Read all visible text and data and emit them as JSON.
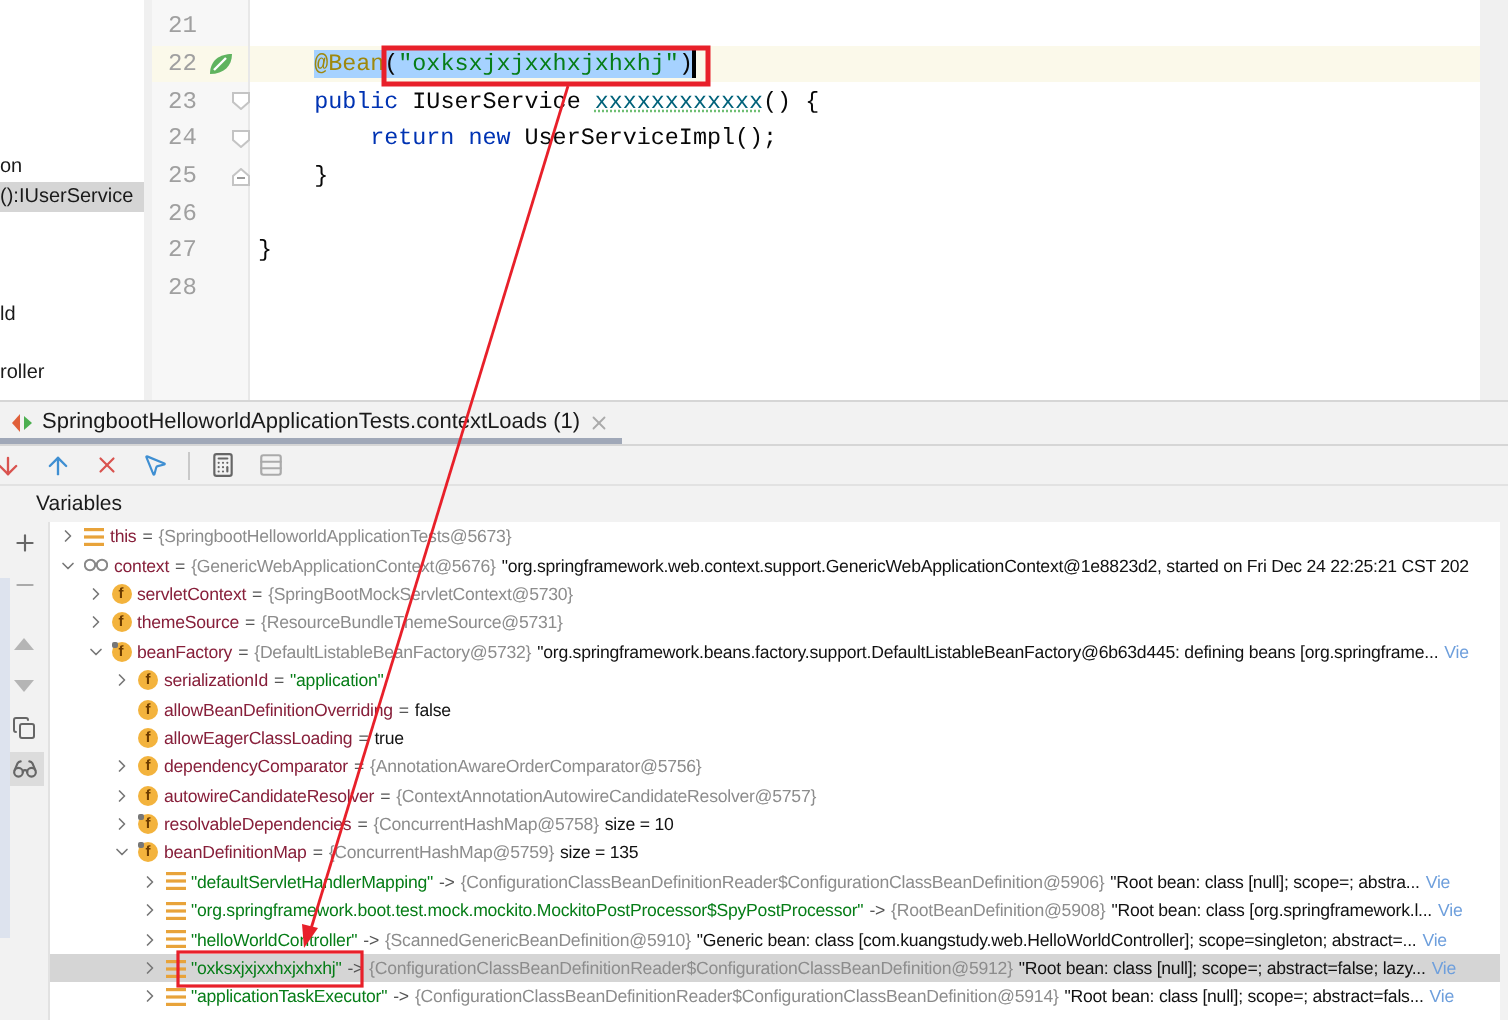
{
  "project_panel": {
    "items": [
      {
        "label": "on",
        "selected": false
      },
      {
        "label": "():IUserService",
        "selected": true
      },
      {
        "label": "ld",
        "selected": false
      },
      {
        "label": "roller",
        "selected": false
      }
    ]
  },
  "editor": {
    "lines": [
      {
        "number": "21",
        "current": false,
        "caret": false,
        "kind": "none"
      },
      {
        "number": "22",
        "current": true,
        "caret": true,
        "kind": "bean",
        "tokens": [
          {
            "kind": "annotation",
            "text": "    @Bean",
            "selected": true
          },
          {
            "kind": "plain",
            "text": "(",
            "selected": true
          },
          {
            "kind": "string",
            "text": "\"oxksxjxjxxhxjxhxhj\"",
            "selected": true
          },
          {
            "kind": "plain",
            "text": ")",
            "selected": true
          }
        ]
      },
      {
        "number": "23",
        "current": false,
        "caret": false,
        "kind": "fold-start",
        "tokens": [
          {
            "kind": "keyword",
            "text": "    public",
            "selected": false
          },
          {
            "kind": "plain",
            "text": " IUserService ",
            "selected": false
          },
          {
            "kind": "method",
            "text": "xxxxxxxxxxxx",
            "selected": false
          },
          {
            "kind": "plain",
            "text": "() {",
            "selected": false
          }
        ]
      },
      {
        "number": "24",
        "current": false,
        "caret": false,
        "kind": "fold-start",
        "tokens": [
          {
            "kind": "keyword",
            "text": "        return",
            "selected": false
          },
          {
            "kind": "keyword",
            "text": " new",
            "selected": false
          },
          {
            "kind": "plain",
            "text": " UserServiceImpl();",
            "selected": false
          }
        ]
      },
      {
        "number": "25",
        "current": false,
        "caret": false,
        "kind": "fold-end",
        "tokens": [
          {
            "kind": "plain",
            "text": "    }",
            "selected": false
          }
        ]
      },
      {
        "number": "26",
        "current": false,
        "caret": false,
        "kind": "none"
      },
      {
        "number": "27",
        "current": false,
        "caret": false,
        "kind": "none",
        "tokens": [
          {
            "kind": "plain",
            "text": "}",
            "selected": false
          }
        ]
      },
      {
        "number": "28",
        "current": false,
        "caret": false,
        "kind": "none"
      }
    ]
  },
  "debug": {
    "tabs": [
      {
        "label": "SpringbootHelloworldApplicationTests.contextLoads (1)",
        "selected": true
      }
    ],
    "variables_title": "Variables",
    "variables": [
      {
        "name": "this",
        "kind": "list",
        "expanded": false,
        "sep": "=",
        "type": "{SpringbootHelloworldApplicationTests@5673}"
      },
      {
        "name": "context",
        "kind": "watch",
        "expanded": true,
        "sep": "=",
        "type": "{GenericWebApplicationContext@5676}",
        "text": "\"org.springframework.web.context.support.GenericWebApplicationContext@1e8823d2, started on Fri Dec 24 22:25:21 CST 202",
        "children": [
          {
            "name": "servletContext",
            "kind": "field",
            "badge": "f",
            "expanded": false,
            "sep": "=",
            "type": "{SpringBootMockServletContext@5730}"
          },
          {
            "name": "themeSource",
            "kind": "field",
            "badge": "f",
            "expanded": false,
            "sep": "=",
            "type": "{ResourceBundleThemeSource@5731}"
          },
          {
            "name": "beanFactory",
            "kind": "final-field",
            "badge": "f",
            "expanded": true,
            "sep": "=",
            "type": "{DefaultListableBeanFactory@5732}",
            "text": "\"org.springframework.beans.factory.support.DefaultListableBeanFactory@6b63d445: defining beans [org.springframe...",
            "link": "Vie",
            "children": [
              {
                "name": "serializationId",
                "kind": "field",
                "badge": "f",
                "expanded": false,
                "sep": "=",
                "string": "\"application\""
              },
              {
                "name": "allowBeanDefinitionOverriding",
                "kind": "field",
                "badge": "f",
                "sep": "=",
                "text": "false"
              },
              {
                "name": "allowEagerClassLoading",
                "kind": "field",
                "badge": "f",
                "sep": "=",
                "text": "true"
              },
              {
                "name": "dependencyComparator",
                "kind": "field",
                "badge": "f",
                "expanded": false,
                "sep": "=",
                "type": "{AnnotationAwareOrderComparator@5756}"
              },
              {
                "name": "autowireCandidateResolver",
                "kind": "field",
                "badge": "f",
                "expanded": false,
                "sep": "=",
                "type": "{ContextAnnotationAutowireCandidateResolver@5757}"
              },
              {
                "name": "resolvableDependencies",
                "kind": "final-field",
                "badge": "f",
                "expanded": false,
                "sep": "=",
                "type": "{ConcurrentHashMap@5758}",
                "text": "size = 10"
              },
              {
                "name": "beanDefinitionMap",
                "kind": "final-field",
                "badge": "f",
                "expanded": true,
                "sep": "=",
                "type": "{ConcurrentHashMap@5759}",
                "text": "size = 135",
                "children": [
                  {
                    "key": "\"defaultServletHandlerMapping\"",
                    "kind": "list",
                    "expanded": false,
                    "selected": false,
                    "sep": "->",
                    "type": "{ConfigurationClassBeanDefinitionReader$ConfigurationClassBeanDefinition@5906}",
                    "text": "\"Root bean: class [null]; scope=; abstra...",
                    "link": "Vie"
                  },
                  {
                    "key": "\"org.springframework.boot.test.mock.mockito.MockitoPostProcessor$SpyPostProcessor\"",
                    "kind": "list",
                    "expanded": false,
                    "selected": false,
                    "sep": "->",
                    "type": "{RootBeanDefinition@5908}",
                    "text": "\"Root bean: class [org.springframework.l...",
                    "link": "Vie"
                  },
                  {
                    "key": "\"helloWorldController\"",
                    "kind": "list",
                    "expanded": false,
                    "selected": false,
                    "sep": "->",
                    "type": "{ScannedGenericBeanDefinition@5910}",
                    "text": "\"Generic bean: class [com.kuangstudy.web.HelloWorldController]; scope=singleton; abstract=...",
                    "link": "Vie"
                  },
                  {
                    "key": "\"oxksxjxjxxhxjxhxhj\"",
                    "kind": "list",
                    "expanded": false,
                    "selected": true,
                    "sep": "->",
                    "type": "{ConfigurationClassBeanDefinitionReader$ConfigurationClassBeanDefinition@5912}",
                    "text": "\"Root bean: class [null]; scope=; abstract=false; lazy...",
                    "link": "Vie"
                  },
                  {
                    "key": "\"applicationTaskExecutor\"",
                    "kind": "list",
                    "expanded": false,
                    "selected": false,
                    "sep": "->",
                    "type": "{ConfigurationClassBeanDefinitionReader$ConfigurationClassBeanDefinition@5914}",
                    "text": "\"Root bean: class [null]; scope=; abstract=fals...",
                    "link": "Vie"
                  }
                ]
              }
            ]
          }
        ]
      }
    ]
  }
}
